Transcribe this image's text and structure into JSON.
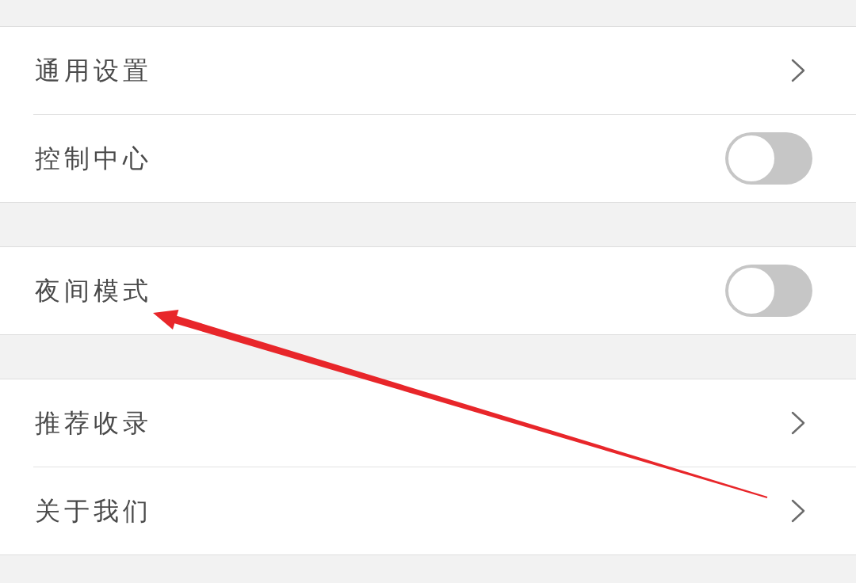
{
  "groups": [
    {
      "items": [
        {
          "label": "通用设置",
          "kind": "link"
        },
        {
          "label": "控制中心",
          "kind": "toggle",
          "on": false
        }
      ]
    },
    {
      "items": [
        {
          "label": "夜间模式",
          "kind": "toggle",
          "on": false
        }
      ]
    },
    {
      "items": [
        {
          "label": "推荐收录",
          "kind": "link"
        },
        {
          "label": "关于我们",
          "kind": "link"
        }
      ]
    }
  ]
}
